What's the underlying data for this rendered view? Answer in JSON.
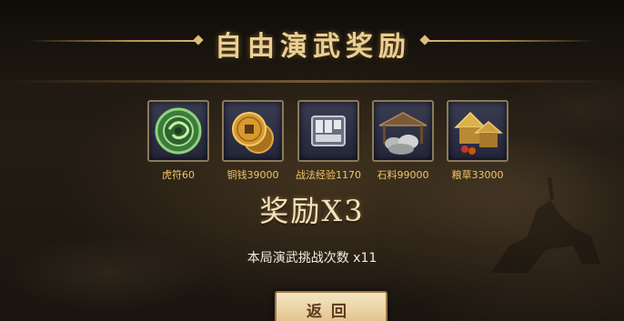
{
  "title": "自由演武奖励",
  "rewards": [
    {
      "label": "虎符60",
      "icon": "tiger-tally-icon"
    },
    {
      "label": "铜钱39000",
      "icon": "copper-coin-icon"
    },
    {
      "label": "战法经验1170",
      "icon": "tactic-experience-icon"
    },
    {
      "label": "石料99000",
      "icon": "stone-material-icon"
    },
    {
      "label": "粮草33000",
      "icon": "grain-supply-icon"
    }
  ],
  "multiplier": "奖励X3",
  "challenge_count": "本局演武挑战次数 x11",
  "back_button": "返回",
  "colors": {
    "title": "#eccf92",
    "reward_label": "#f2c668",
    "slot_bg": "#2d3045",
    "button_bg": "#ecd3a3"
  }
}
